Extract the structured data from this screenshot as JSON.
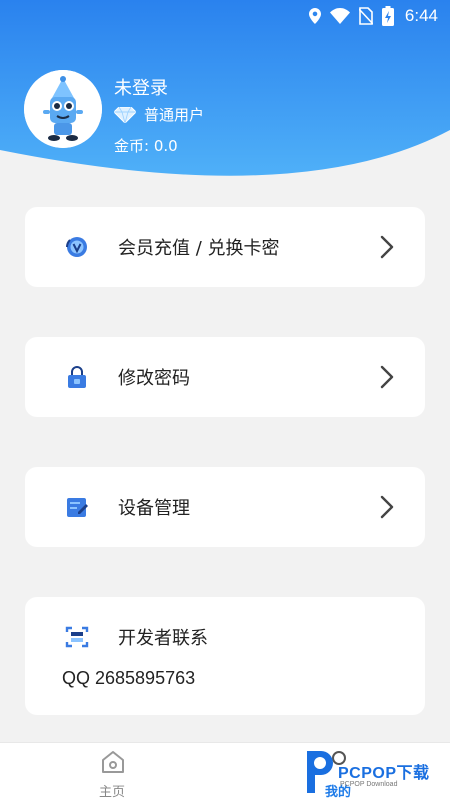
{
  "status_bar": {
    "time": "6:44"
  },
  "profile": {
    "name": "未登录",
    "level": "普通用户",
    "coins": "金币: 0.0"
  },
  "menu": {
    "items": [
      {
        "label": "会员充值 / 兑换卡密",
        "icon": "vip-recharge-icon"
      },
      {
        "label": "修改密码",
        "icon": "lock-icon"
      },
      {
        "label": "设备管理",
        "icon": "edit-device-icon"
      }
    ]
  },
  "contact": {
    "title": "开发者联系",
    "qq": "QQ 2685895763"
  },
  "bottom_nav": {
    "home_label": "主页",
    "mine_label": "我的"
  },
  "watermark": {
    "brand": "PCPOP下载",
    "sub": "PCPOP Download"
  },
  "colors": {
    "accent": "#1e7be8",
    "header_top": "#2a82ee",
    "header_bottom": "#4aa8f6",
    "icon_blue": "#2d6fd6"
  }
}
